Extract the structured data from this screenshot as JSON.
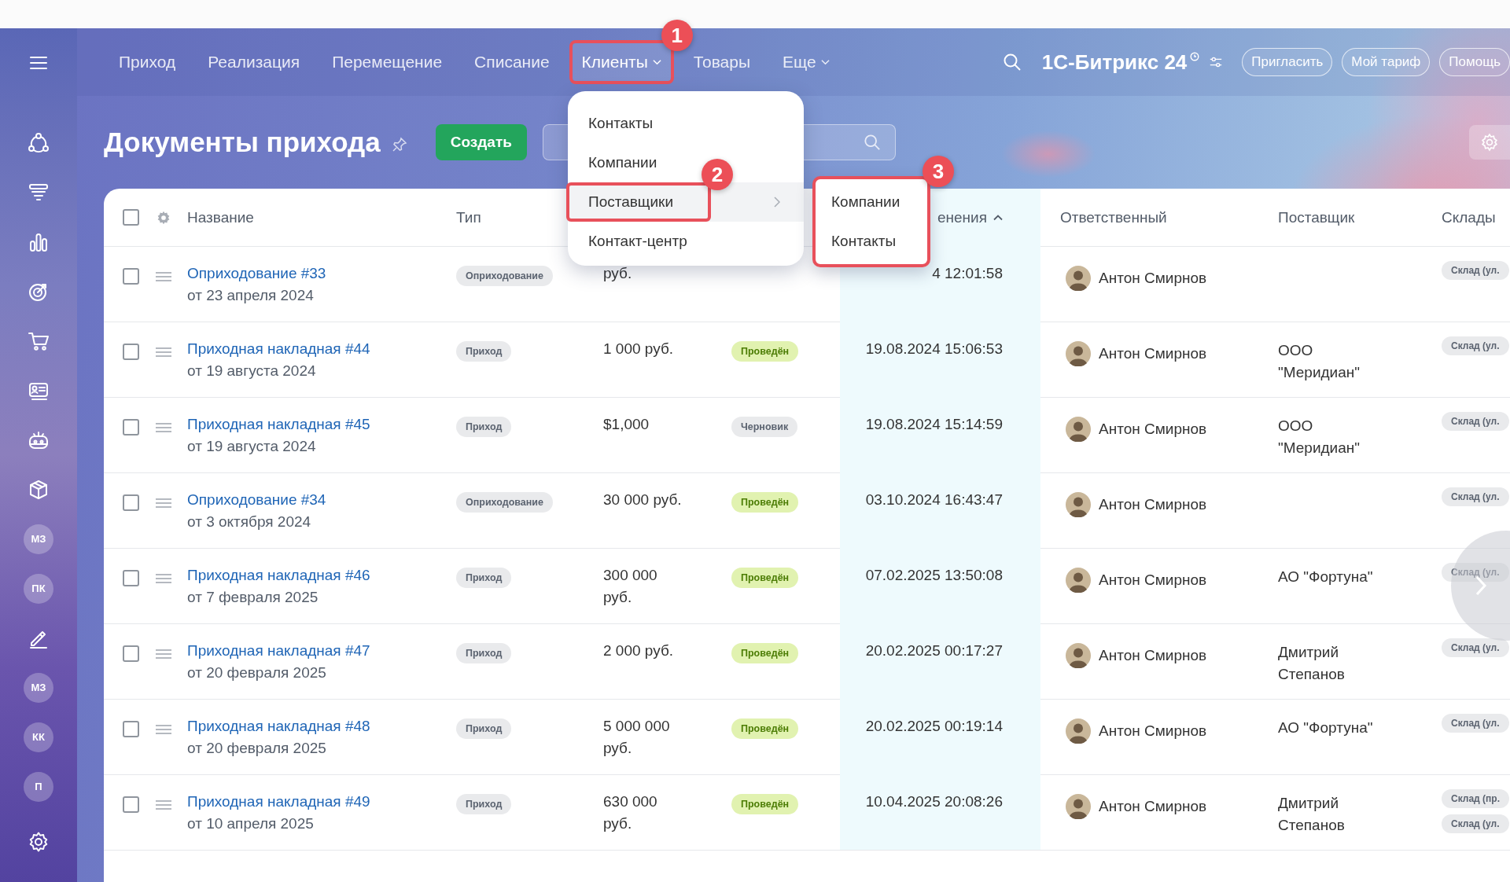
{
  "sidebar": {
    "items": [
      {
        "kind": "icon"
      },
      {
        "kind": "icon"
      },
      {
        "kind": "icon"
      },
      {
        "kind": "icon"
      },
      {
        "kind": "icon"
      },
      {
        "kind": "icon"
      },
      {
        "kind": "icon"
      },
      {
        "kind": "icon"
      },
      {
        "kind": "icon"
      },
      {
        "kind": "avatar",
        "label": "МЗ"
      },
      {
        "kind": "avatar",
        "label": "ПК"
      },
      {
        "kind": "icon"
      },
      {
        "kind": "avatar",
        "label": "МЗ"
      },
      {
        "kind": "avatar",
        "label": "КК"
      },
      {
        "kind": "avatar",
        "label": "П"
      },
      {
        "kind": "icon"
      }
    ]
  },
  "nav": {
    "items": [
      {
        "label": "Приход",
        "selected": false,
        "dropdown": false
      },
      {
        "label": "Реализация",
        "selected": false,
        "dropdown": false
      },
      {
        "label": "Перемещение",
        "selected": false,
        "dropdown": false
      },
      {
        "label": "Списание",
        "selected": false,
        "dropdown": false
      },
      {
        "label": "Клиенты",
        "selected": true,
        "dropdown": true,
        "callout": "1"
      },
      {
        "label": "Товары",
        "selected": false,
        "dropdown": false
      },
      {
        "label": "Еще",
        "selected": false,
        "dropdown": true
      }
    ],
    "brand": "1С-Битрикс 24",
    "buttons": [
      "Пригласить",
      "Мой тариф",
      "Помощь"
    ]
  },
  "page": {
    "title": "Документы прихода",
    "create_button": "Создать"
  },
  "menu": {
    "items": [
      {
        "label": "Контакты",
        "selected": false,
        "submenu": false
      },
      {
        "label": "Компании",
        "selected": false,
        "submenu": false
      },
      {
        "label": "Поставщики",
        "selected": true,
        "submenu": true,
        "callout": "2"
      },
      {
        "label": "Контакт-центр",
        "selected": false,
        "submenu": false
      }
    ]
  },
  "submenu": {
    "callout": "3",
    "items": [
      "Компании",
      "Контакты"
    ]
  },
  "table": {
    "select_all_checked": false,
    "columns": [
      {
        "kind": "name",
        "label": "Название"
      },
      {
        "kind": "type",
        "label": "Тип"
      },
      {
        "kind": "modified",
        "label": "енения",
        "sorted": true
      },
      {
        "kind": "responsible",
        "label": "Ответственный"
      },
      {
        "kind": "supplier",
        "label": "Поставщик"
      },
      {
        "kind": "stores",
        "label": "Склады"
      }
    ],
    "rows": [
      {
        "checked": false,
        "title": "Оприходование #33",
        "date": "от 23 апреля 2024",
        "type": "Оприходование",
        "amount": "руб.",
        "modified": "4 12:01:58",
        "responsible": "Антон Смирнов",
        "stores": [
          "Склад (ул."
        ]
      },
      {
        "checked": false,
        "title": "Приходная накладная #44",
        "date": "от 19 августа 2024",
        "type": "Приход",
        "amount": "1 000 руб.",
        "status": {
          "label": "Проведён",
          "kind": "posted"
        },
        "modified": "19.08.2024 15:06:53",
        "responsible": "Антон Смирнов",
        "supplier": "ООО \"Меридиан\"",
        "stores": [
          "Склад (ул."
        ]
      },
      {
        "checked": false,
        "title": "Приходная накладная #45",
        "date": "от 19 августа 2024",
        "type": "Приход",
        "amount": "$1,000",
        "status": {
          "label": "Черновик",
          "kind": "draft"
        },
        "modified": "19.08.2024 15:14:59",
        "responsible": "Антон Смирнов",
        "supplier": "ООО \"Меридиан\"",
        "stores": [
          "Склад (ул."
        ]
      },
      {
        "checked": false,
        "title": "Оприходование #34",
        "date": "от 3 октября 2024",
        "type": "Оприходование",
        "amount": "30 000 руб.",
        "status": {
          "label": "Проведён",
          "kind": "posted"
        },
        "modified": "03.10.2024 16:43:47",
        "responsible": "Антон Смирнов",
        "stores": [
          "Склад (ул."
        ]
      },
      {
        "checked": false,
        "title": "Приходная накладная #46",
        "date": "от 7 февраля 2025",
        "type": "Приход",
        "amount": "300 000 руб.",
        "status": {
          "label": "Проведён",
          "kind": "posted"
        },
        "modified": "07.02.2025 13:50:08",
        "responsible": "Антон Смирнов",
        "supplier": "АО \"Фортуна\"",
        "stores": [
          "Склад (ул."
        ]
      },
      {
        "checked": false,
        "title": "Приходная накладная #47",
        "date": "от 20 февраля 2025",
        "type": "Приход",
        "amount": "2 000 руб.",
        "status": {
          "label": "Проведён",
          "kind": "posted"
        },
        "modified": "20.02.2025 00:17:27",
        "responsible": "Антон Смирнов",
        "supplier": "Дмитрий Степанов",
        "stores": [
          "Склад (ул."
        ]
      },
      {
        "checked": false,
        "title": "Приходная накладная #48",
        "date": "от 20 февраля 2025",
        "type": "Приход",
        "amount": "5 000 000 руб.",
        "status": {
          "label": "Проведён",
          "kind": "posted"
        },
        "modified": "20.02.2025 00:19:14",
        "responsible": "Антон Смирнов",
        "supplier": "АО \"Фортуна\"",
        "stores": [
          "Склад (ул."
        ]
      },
      {
        "checked": false,
        "title": "Приходная накладная #49",
        "date": "от 10 апреля 2025",
        "type": "Приход",
        "amount": "630 000 руб.",
        "status": {
          "label": "Проведён",
          "kind": "posted"
        },
        "modified": "10.04.2025 20:08:26",
        "responsible": "Антон Смирнов",
        "supplier": "Дмитрий Степанов",
        "stores": [
          "Склад (пр.",
          "Склад (ул."
        ]
      }
    ]
  }
}
